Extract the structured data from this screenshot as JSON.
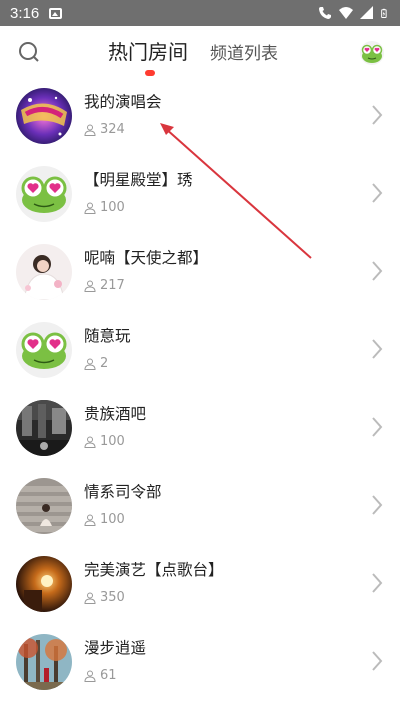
{
  "status_bar": {
    "time": "3:16"
  },
  "header": {
    "tabs": [
      {
        "label": "热门房间",
        "active": true
      },
      {
        "label": "频道列表",
        "active": false
      }
    ]
  },
  "rooms": [
    {
      "name": "我的演唱会",
      "count": "324",
      "cover": "concert"
    },
    {
      "name": "【明星殿堂】琇",
      "count": "100",
      "cover": "frog"
    },
    {
      "name": "呢喃【天使之都】",
      "count": "217",
      "cover": "girl-white"
    },
    {
      "name": "随意玩",
      "count": "2",
      "cover": "frog"
    },
    {
      "name": "贵族酒吧",
      "count": "100",
      "cover": "bar"
    },
    {
      "name": "情系司令部",
      "count": "100",
      "cover": "stairs"
    },
    {
      "name": "完美演艺【点歌台】",
      "count": "350",
      "cover": "lamp"
    },
    {
      "name": "漫步逍遥",
      "count": "61",
      "cover": "forest"
    }
  ],
  "colors": {
    "accent": "#ff3b30",
    "annotation_arrow": "#d9363e",
    "frog_green": "#7bc043",
    "frog_eye": "#e2308a"
  },
  "icons": [
    "search-icon",
    "frog-avatar-icon",
    "person-icon",
    "chevron-right-icon"
  ]
}
